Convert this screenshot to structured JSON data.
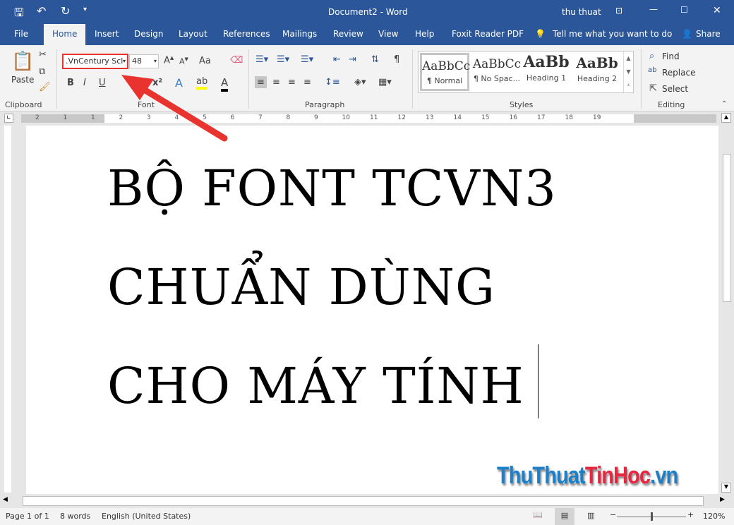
{
  "titlebar": {
    "title": "Document2  -  Word",
    "user": "thu thuat"
  },
  "tabs": [
    "File",
    "Home",
    "Insert",
    "Design",
    "Layout",
    "References",
    "Mailings",
    "Review",
    "View",
    "Help",
    "Foxit Reader PDF"
  ],
  "tell_me": "Tell me what you want to do",
  "share": "Share",
  "ribbon": {
    "clipboard": {
      "paste": "Paste",
      "label": "Clipboard"
    },
    "font": {
      "name": ".VnCentury Scl",
      "size": "48",
      "label": "Font",
      "case": "Aa",
      "bold": "B",
      "italic": "I",
      "underline": "U",
      "super": "x²"
    },
    "paragraph": {
      "label": "Paragraph"
    },
    "styles": {
      "label": "Styles",
      "items": [
        {
          "preview": "AaBbCc",
          "name": "¶ Normal"
        },
        {
          "preview": "AaBbCc",
          "name": "¶ No Spac..."
        },
        {
          "preview": "AaBb",
          "name": "Heading 1"
        },
        {
          "preview": "AaBb",
          "name": "Heading 2"
        }
      ]
    },
    "editing": {
      "label": "Editing",
      "find": "Find",
      "replace": "Replace",
      "select": "Select"
    }
  },
  "ruler": [
    "2",
    "1",
    "1",
    "2",
    "3",
    "4",
    "5",
    "6",
    "7",
    "8",
    "9",
    "10",
    "11",
    "12",
    "13",
    "14",
    "15",
    "16",
    "17",
    "18",
    "19"
  ],
  "document": {
    "lines": [
      "BỘ FONT TCVN3",
      "CHUẨN DÙNG",
      "CHO MÁY TÍNH"
    ]
  },
  "watermark": {
    "part1": "ThuThuat",
    "part2": "TinHoc",
    "part3": ".vn"
  },
  "status": {
    "page": "Page 1 of 1",
    "words": "8 words",
    "language": "English (United States)",
    "zoom": "120%"
  },
  "colors": {
    "brand": "#2b579a",
    "highlight": "#e8332e"
  }
}
